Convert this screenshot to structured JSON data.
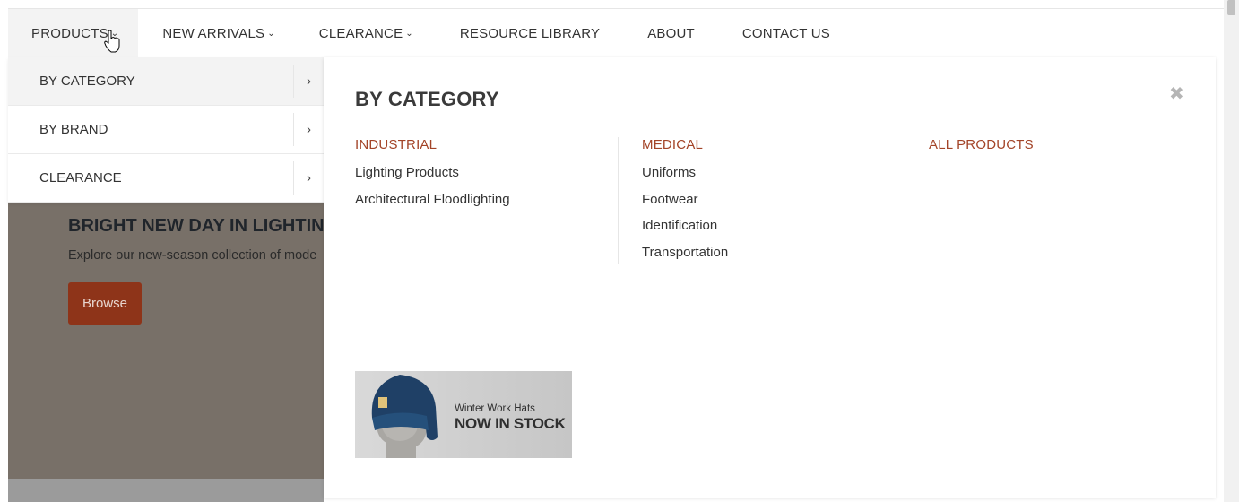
{
  "nav": {
    "items": [
      {
        "label": "PRODUCTS",
        "chevron": true,
        "active": true
      },
      {
        "label": "NEW ARRIVALS",
        "chevron": true
      },
      {
        "label": "CLEARANCE",
        "chevron": true
      },
      {
        "label": "RESOURCE LIBRARY",
        "chevron": false
      },
      {
        "label": "ABOUT",
        "chevron": false
      },
      {
        "label": "CONTACT US",
        "chevron": false
      }
    ]
  },
  "submenu": {
    "items": [
      {
        "label": "BY CATEGORY",
        "arrow": "›"
      },
      {
        "label": "BY BRAND",
        "arrow": "›"
      },
      {
        "label": "CLEARANCE",
        "arrow": "›"
      }
    ]
  },
  "panel": {
    "title": "BY CATEGORY",
    "close": "✖",
    "columns": [
      {
        "heading": "INDUSTRIAL",
        "links": [
          "Lighting Products",
          "Architectural Floodlighting"
        ]
      },
      {
        "heading": "MEDICAL",
        "links": [
          "Uniforms",
          "Footwear",
          "Identification",
          "Transportation"
        ]
      },
      {
        "heading": "ALL PRODUCTS",
        "links": []
      }
    ],
    "banner": {
      "small": "Winter Work Hats",
      "big": "NOW IN STOCK"
    }
  },
  "hero": {
    "title": "BRIGHT NEW DAY IN LIGHTING",
    "subtitle": "Explore our new-season collection of mode",
    "button": "Browse"
  },
  "colors": {
    "accent": "#a34428",
    "button": "#8e3419",
    "hero_bg": "#787068"
  },
  "icons": {
    "nav_chevron": "chevron-down-icon",
    "submenu_arrow": "chevron-right-icon",
    "close": "close-icon",
    "cursor": "hand-pointer-icon"
  }
}
